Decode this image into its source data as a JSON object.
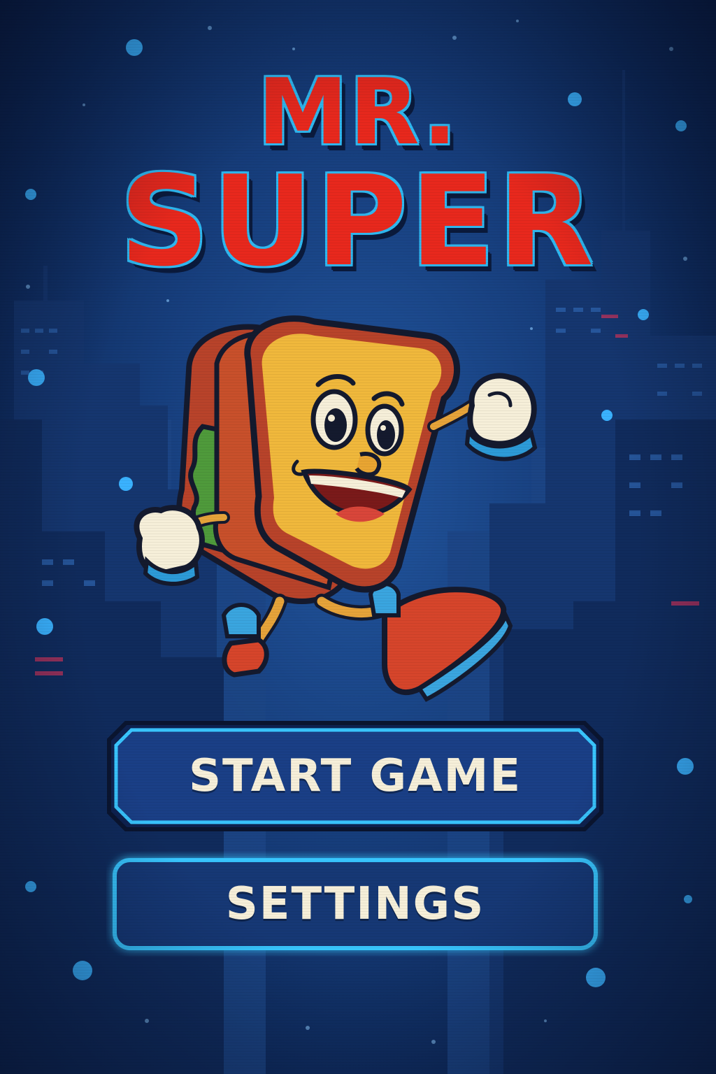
{
  "game": {
    "title_line1": "MR.",
    "title_line2": "SUPER"
  },
  "menu": {
    "start_label": "START GAME",
    "settings_label": "SETTINGS"
  },
  "mascot": {
    "name": "sandwich-character"
  },
  "colors": {
    "title_red": "#e8281d",
    "title_outline": "#2fb8f0",
    "background": "#173f7e",
    "button_glow": "#39c6ff",
    "button_fill": "#1a3f86",
    "label": "#f6efd9"
  }
}
